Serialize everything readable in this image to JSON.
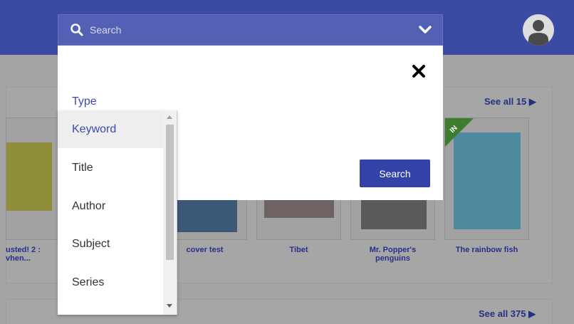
{
  "search": {
    "placeholder": "Search"
  },
  "modal": {
    "type_label": "Type",
    "search_button": "Search"
  },
  "type_options": [
    {
      "label": "Keyword",
      "selected": true
    },
    {
      "label": "Title",
      "selected": false
    },
    {
      "label": "Author",
      "selected": false
    },
    {
      "label": "Subject",
      "selected": false
    },
    {
      "label": "Series",
      "selected": false
    }
  ],
  "shelf1": {
    "see_all": "See all 15",
    "books": [
      {
        "title_line1": "usted! 2 :",
        "title_line2": "vhen..."
      },
      {
        "title_line1": "cover test",
        "title_line2": ""
      },
      {
        "title_line1": "Tibet",
        "title_line2": ""
      },
      {
        "title_line1": "Mr. Popper's",
        "title_line2": "penguins"
      },
      {
        "title_line1": "The rainbow fish",
        "title_line2": ""
      }
    ],
    "badge": "IN"
  },
  "shelf2": {
    "see_all": "See all 375"
  },
  "colors": {
    "header": "#3b4aa3",
    "accent": "#3342a7",
    "link": "#243080"
  }
}
